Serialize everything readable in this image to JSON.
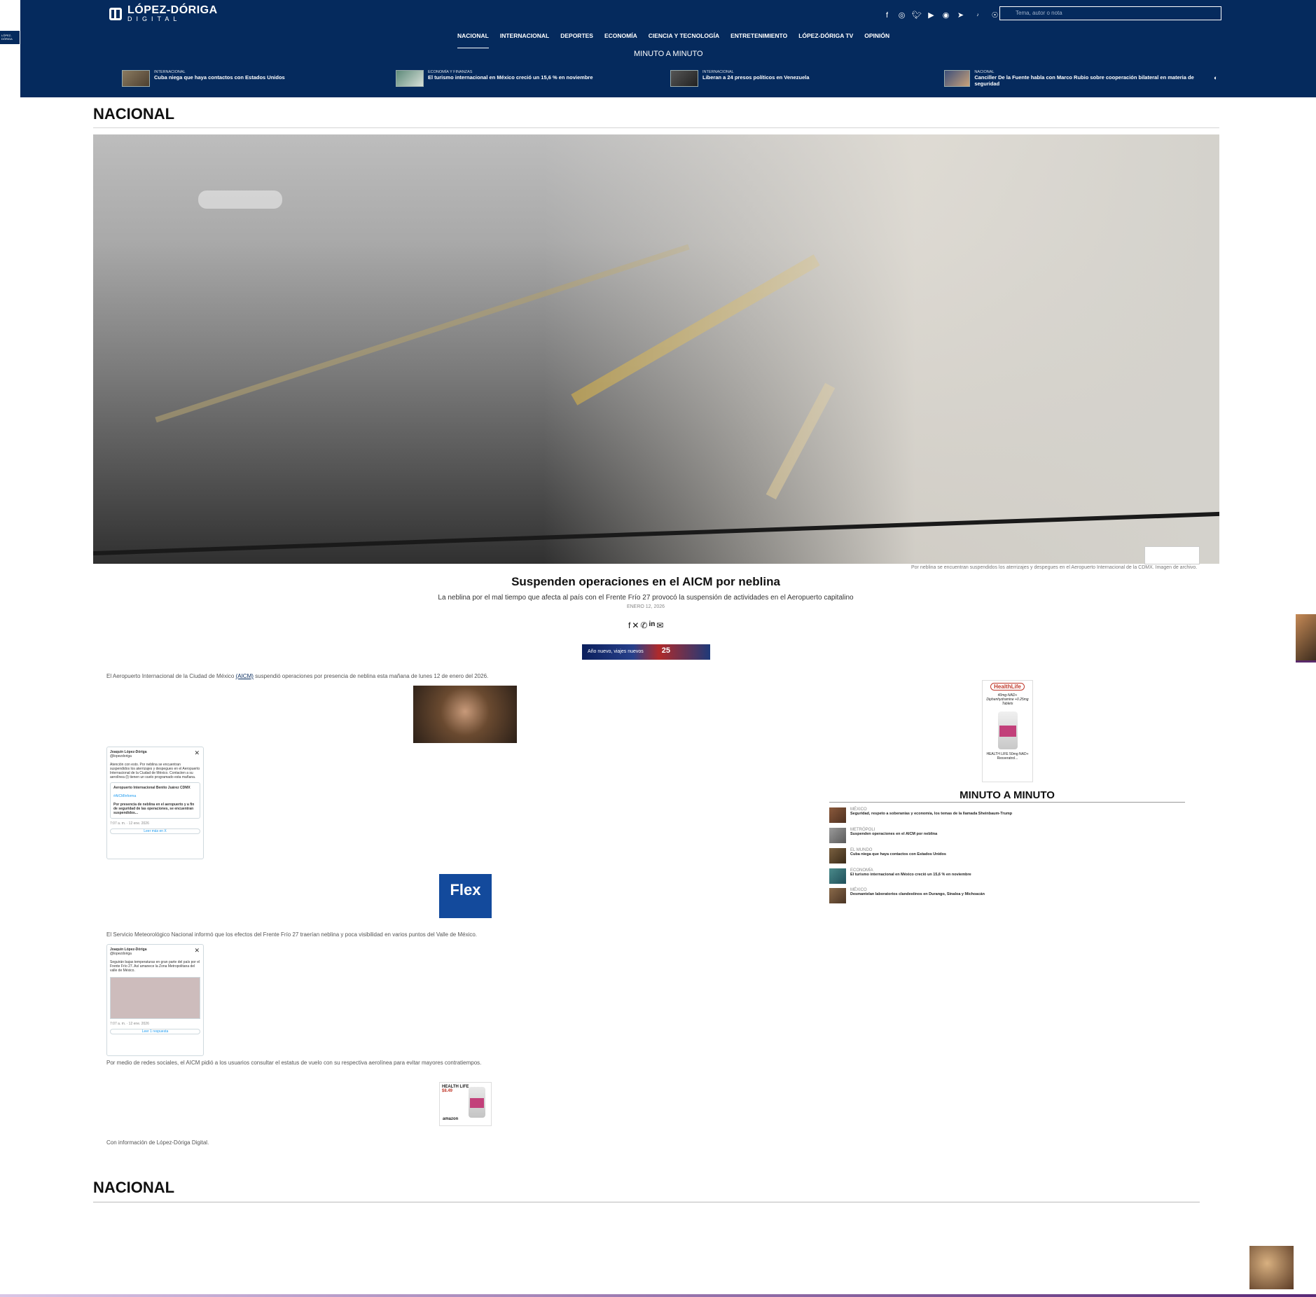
{
  "site": {
    "logo_title": "LÓPEZ-DÓRIGA",
    "logo_subtitle": "DIGITAL",
    "corner_label": "LÓPEZ-DÓRIGA"
  },
  "social_icons": [
    "facebook-icon",
    "instagram-icon",
    "twitter-icon",
    "youtube-icon",
    "spotify-icon",
    "telegram-icon",
    "amazon-music-icon",
    "podcast-icon"
  ],
  "search": {
    "placeholder": "Tema, autor o nota"
  },
  "nav": {
    "items": [
      "NACIONAL",
      "INTERNACIONAL",
      "DEPORTES",
      "ECONOMÍA",
      "CIENCIA Y TECNOLOGÍA",
      "ENTRETENIMIENTO",
      "LÓPEZ-DÓRIGA TV",
      "OPINIÓN"
    ],
    "active": "NACIONAL",
    "minute": "MINUTO A MINUTO"
  },
  "ticker": [
    {
      "category": "INTERNACIONAL",
      "title": "Cuba niega que haya contactos con Estados Unidos"
    },
    {
      "category": "ECONOMÍA Y FINANZAS",
      "title": "El turismo internacional en México creció un 15,6 % en noviembre"
    },
    {
      "category": "INTERNACIONAL",
      "title": "Liberan a 24 presos políticos en Venezuela"
    },
    {
      "category": "NACIONAL",
      "title": "Canciller De la Fuente habla con Marco Rubio sobre cooperación bilateral en materia de seguridad"
    }
  ],
  "section": {
    "title": "NACIONAL"
  },
  "article": {
    "image_caption": "Por neblina se encuentran suspendidos los aterrizajes y despegues en el Aeropuerto Internacional de la CDMX. Imagen de archivo.",
    "headline": "Suspenden operaciones en el AICM por neblina",
    "subhead": "La neblina por el mal tiempo que afecta al país con el Frente Frío 27 provocó la suspensión de actividades en el Aeropuerto capitalino",
    "date": "ENERO 12, 2026",
    "p1_before": "El Aeropuerto Internacional de la Ciudad de México ",
    "p1_link": "(AICM)",
    "p1_after": " suspendió operaciones por presencia de neblina esta mañana de lunes 12 de enero del 2026.",
    "p2": "El Servicio Meteorológico Nacional informó que los efectos del Frente Frío 27 traerían neblina y poca visibilidad en varios puntos del Valle de México.",
    "p3": "Por medio de redes sociales, el AICM pidió a los usuarios consultar el estatus de vuelo con su respectiva aerolínea para evitar mayores contratiempos.",
    "p4": "Con información de López-Dóriga Digital."
  },
  "tweets": [
    {
      "author": "Joaquín López-Dóriga",
      "handle": "@lopezdoriga",
      "body": "Atención con esto. Por neblina se encuentran suspendidos los aterrizajes y despegues en el Aeropuerto Internacional de la Ciudad de México. Contacten a su aerolínea (I) tienen un vuelo programado esta mañana.",
      "embed_author": "Aeropuerto Internacional Benito Juárez CDMX",
      "embed_tag": "#AICMInforma",
      "embed_body": "Por presencia de neblina en el aeropuerto y a fin de seguridad de las operaciones, se encuentran suspendidos...",
      "time": "7:07 a. m. · 12 ene. 2026",
      "button": "Leer más en X"
    },
    {
      "author": "Joaquín López-Dóriga",
      "handle": "@lopezdoriga",
      "body": "Seguirán bajas temperaturas en gran parte del país por el Frente Frío 27. Así amanece la Zona Metropolitana del valle de México.",
      "time": "7:07 a. m. · 12 ene. 2026",
      "button": "Leer 1 respuesta"
    }
  ],
  "ads": {
    "banner_text": "Año nuevo, viajes nuevos",
    "banner_badge": "25",
    "flex_label": "Flex",
    "product_brand": "HEALTH LIFE",
    "product_price": "$8.49",
    "product_seller": "amazon",
    "side_brand": "HealthLife",
    "side_text": "40mg-NAD+ Diphenhydramine +0.25mg Tablets",
    "side_caption": "HEALTH LIFE 50mg NAD+ Resveratrol..."
  },
  "minuto": {
    "title": "MINUTO A MINUTO",
    "items": [
      {
        "category": "MÉXICO",
        "title": "Seguridad, respeto a soberanías y economía, los temas de la llamada Sheinbaum-Trump"
      },
      {
        "category": "METRÓPOLI",
        "title": "Suspenden operaciones en el AICM por neblina"
      },
      {
        "category": "EL MUNDO",
        "title": "Cuba niega que haya contactos con Estados Unidos"
      },
      {
        "category": "ECONOMÍA",
        "title": "El turismo internacional en México creció un 15,6 % en noviembre"
      },
      {
        "category": "MÉXICO",
        "title": "Desmantelan laboratorios clandestinos en Durango, Sinaloa y Michoacán"
      }
    ]
  },
  "footer_section": {
    "title": "NACIONAL"
  },
  "colors": {
    "header_bg": "#052a5d",
    "accent_purple": "#5a2a78"
  }
}
